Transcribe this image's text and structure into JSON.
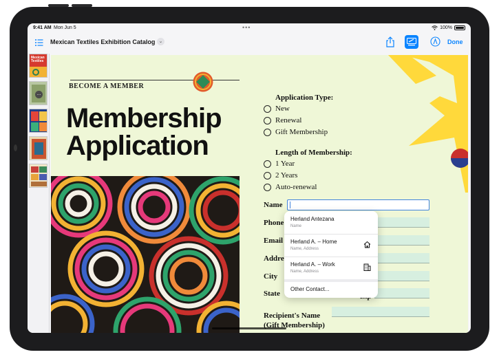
{
  "status_bar": {
    "time": "9:41 AM",
    "date": "Mon Jun 5",
    "battery": "100%"
  },
  "toolbar": {
    "title": "Mexican Textiles Exhibition Catalog",
    "done_label": "Done"
  },
  "sidebar": {
    "thumbnail_1_text": "Mexican Textiles",
    "more_label": "..."
  },
  "document": {
    "eyebrow": "BECOME A MEMBER",
    "headline_line1": "Membership",
    "headline_line2": "Application",
    "application_type": {
      "label": "Application Type:",
      "options": [
        "New",
        "Renewal",
        "Gift Membership"
      ]
    },
    "length": {
      "label": "Length of Membership:",
      "options": [
        "1 Year",
        "2 Years",
        "Auto-renewal"
      ]
    },
    "fields": {
      "name": "Name",
      "phone": "Phone",
      "email": "Email",
      "address": "Address",
      "city": "City",
      "state": "State",
      "zip": "Zip",
      "recipient_line1": "Recipient's Name",
      "recipient_line2": "(Gift Membership)"
    }
  },
  "autofill_popup": {
    "items": [
      {
        "name": "Herland Antezana",
        "sub": "Name"
      },
      {
        "name": "Herland A. – Home",
        "sub": "Name, Address",
        "icon": "house-icon"
      },
      {
        "name": "Herland A. – Work",
        "sub": "Name, Address",
        "icon": "building-icon"
      }
    ],
    "other": "Other Contact..."
  },
  "colors": {
    "accent": "#0a84ff",
    "page_bg": "#eff7d7",
    "field_fill": "#d7efe0",
    "sun_yellow": "#ffd93b"
  }
}
